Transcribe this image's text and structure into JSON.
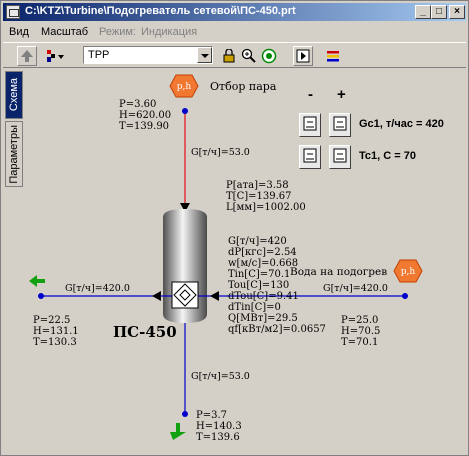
{
  "window": {
    "title": "C:\\KTZ\\Turbine\\Подогреватель сетевой\\ПС-450.prt",
    "minimize": "_",
    "maximize": "□",
    "close": "×"
  },
  "menu": {
    "items": [
      "Вид",
      "Масштаб"
    ],
    "mode_label": "Режим:",
    "mode_value": "Индикация"
  },
  "toolbar": {
    "select_value": "ТРР"
  },
  "tabs": [
    "Схема",
    "Параметры"
  ],
  "diagram": {
    "title": "ПС-450",
    "controls": {
      "minus": "-",
      "plus": "+",
      "gc1": "Gc1, т/час = 420",
      "tc1": "Tc1, C = 70"
    },
    "steam_inlet": {
      "badge": "p,h",
      "label": "Отбор пара",
      "P": "P=3.60",
      "H": "H=620.00",
      "T": "T=139.90",
      "G": "G[т/ч]=53.0"
    },
    "heater_params": {
      "p": "P[ата]=3.58",
      "t": "T[C]=139.67",
      "l": "L[мм]=1002.00"
    },
    "water_params": [
      "G[т/ч]=420",
      "dP[кгс]=2.54",
      "w[м/с]=0.668",
      "Tin[C]=70.1",
      "Tou[C]=130",
      "dTou[C]=9.41",
      "dTin[C]=0",
      "Q[МВт]=29.5",
      "qf[кВт/м2]=0.0657"
    ],
    "water_inlet": {
      "badge": "p,h",
      "label": "Вода на подогрев",
      "G": "G[т/ч]=420.0",
      "P": "P=25.0",
      "H": "H=70.5",
      "T": "T=70.1"
    },
    "water_outlet": {
      "G": "G[т/ч]=420.0",
      "P": "P=22.5",
      "H": "H=131.1",
      "T": "T=130.3"
    },
    "condensate": {
      "G": "G[т/ч]=53.0",
      "P": "P=3.7",
      "H": "H=140.3",
      "T": "T=139.6"
    }
  },
  "colors": {
    "steam_line": "#e01010",
    "water_line": "#0000cc",
    "badge": "#f07830",
    "arrow_green": "#10a010"
  }
}
